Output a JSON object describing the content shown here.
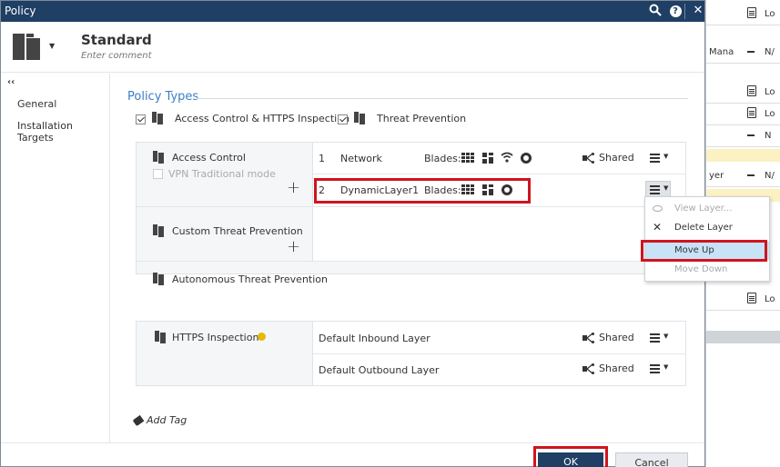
{
  "window": {
    "title": "Policy"
  },
  "header": {
    "policy_name": "Standard",
    "comment_placeholder": "Enter comment"
  },
  "sidebar": {
    "collapse_glyph": "‹‹",
    "items": [
      {
        "label": "General"
      },
      {
        "label": "Installation Targets"
      }
    ]
  },
  "policy_types": {
    "title": "Policy Types",
    "access_control_https": {
      "label": "Access Control & HTTPS Inspection",
      "checked": true
    },
    "threat_prevention": {
      "label": "Threat Prevention",
      "checked": true
    }
  },
  "access_control": {
    "label": "Access Control",
    "vpn_mode": {
      "label": "VPN Traditional mode",
      "checked": false
    },
    "layers": [
      {
        "index": "1",
        "name": "Network",
        "blades_label": "Blades:",
        "blades": [
          "firewall-icon",
          "applications-icon",
          "mobile-access-icon",
          "content-awareness-icon"
        ],
        "shared_label": "Shared"
      },
      {
        "index": "2",
        "name": "DynamicLayer1",
        "blades_label": "Blades:",
        "blades": [
          "firewall-icon",
          "applications-icon",
          "content-awareness-icon"
        ]
      }
    ]
  },
  "custom_threat_prevention": {
    "label": "Custom Threat Prevention"
  },
  "autonomous_threat_prevention": {
    "label": "Autonomous Threat Prevention"
  },
  "https_inspection": {
    "label": "HTTPS Inspection",
    "layers": [
      {
        "name": "Default Inbound Layer",
        "shared_label": "Shared"
      },
      {
        "name": "Default Outbound Layer",
        "shared_label": "Shared"
      }
    ]
  },
  "layer_menu": {
    "items": [
      {
        "label": "View Layer...",
        "enabled": false,
        "icon": "eye-icon"
      },
      {
        "label": "Delete Layer",
        "enabled": true,
        "icon": "close-icon"
      },
      {
        "label": "Move Up",
        "enabled": true,
        "highlighted": true
      },
      {
        "label": "Move Down",
        "enabled": false
      }
    ]
  },
  "add_tag": {
    "label": "Add Tag"
  },
  "footer": {
    "ok_label": "OK",
    "cancel_label": "Cancel"
  },
  "background_app": {
    "rows": [
      {
        "text": "",
        "icon": "doc-icon",
        "value": "Lo"
      },
      {
        "text": "Mana",
        "icon": "dash-icon",
        "value": "N/"
      },
      {
        "text": "",
        "icon": "doc-icon",
        "value": "Lo"
      },
      {
        "text": "",
        "icon": "doc-icon",
        "value": "Lo"
      },
      {
        "text": "",
        "icon": "dash-icon",
        "value": "N"
      },
      {
        "text": "yer",
        "icon": "dash-icon",
        "value": "N/"
      },
      {
        "text": "",
        "icon": "doc-icon",
        "value": "Lo"
      }
    ]
  },
  "colors": {
    "title_bar": "#1f3f64",
    "accent": "#3b7fc4",
    "highlight_red": "#d0141e",
    "menu_highlight": "#c8e2f7"
  }
}
